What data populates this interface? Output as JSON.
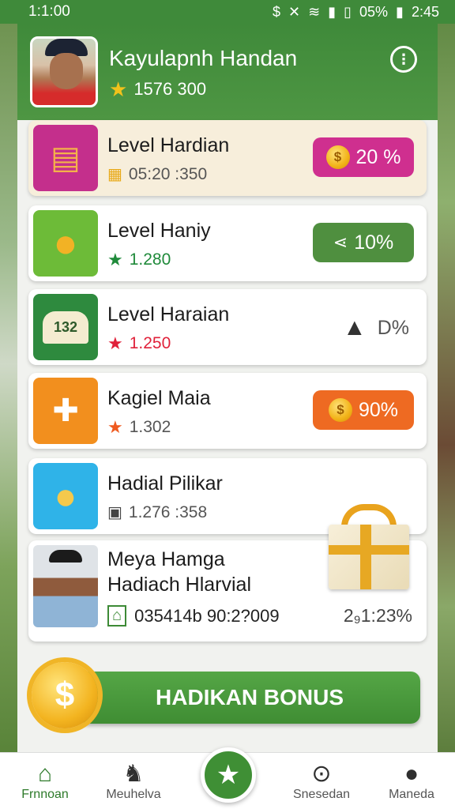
{
  "status_bar": {
    "time_left": "1:1:00",
    "battery": "05%",
    "time_right": "2:45"
  },
  "profile": {
    "name": "Kayulapnh Handan",
    "score": "1576 300"
  },
  "cards": [
    {
      "title": "Level Hardian",
      "meta": "05:20 :350",
      "badge": "20 %",
      "badge_color": "#cf2f8f"
    },
    {
      "title": "Level Haniy",
      "meta": "1.280",
      "badge": "10%",
      "badge_color": "#4f8f3f"
    },
    {
      "title": "Level Haraian",
      "meta": "1.250",
      "badge": "D%",
      "thumb_label": "132"
    },
    {
      "title": "Kagiel Maia",
      "meta": "1.302",
      "badge": "90%",
      "badge_color": "#ee6a22"
    },
    {
      "title": "Hadial Pilikar",
      "meta": "1.276 :358"
    }
  ],
  "feature_card": {
    "line1": "Meya Hamga",
    "line2": "Hadiach Hlarvial",
    "meta": "035414b 90:2?009",
    "pct": "2₉1:23%"
  },
  "bonus": {
    "label": "HADIKAN BONUS"
  },
  "nav": {
    "items": [
      "Frnnoan",
      "Meuhelva",
      "Snesedan",
      "Maneda"
    ]
  }
}
